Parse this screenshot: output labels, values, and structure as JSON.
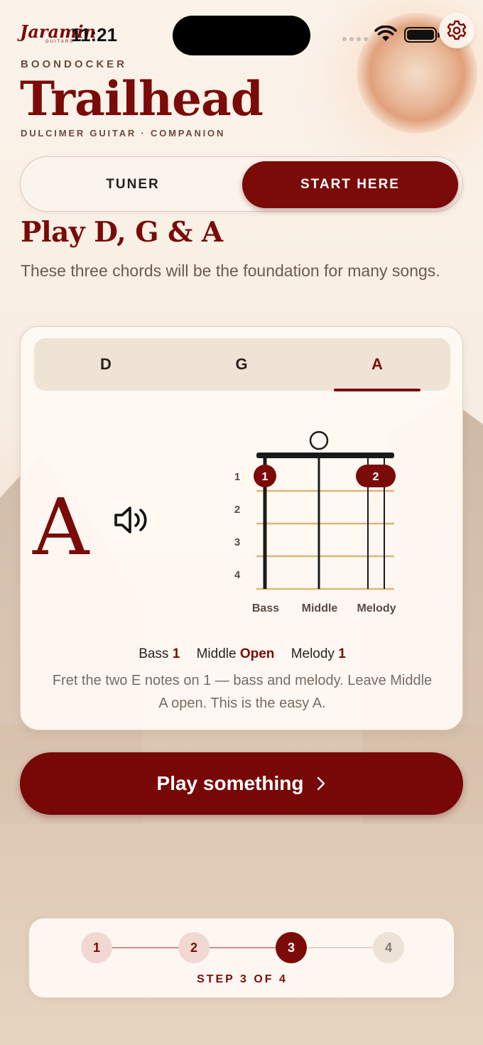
{
  "status_bar": {
    "brand_logo": "Jaramin",
    "brand_logo_sub": "GUITARS",
    "time": "11:21"
  },
  "header": {
    "eyebrow": "BOONDOCKER",
    "title": "Trailhead",
    "subtitle": "DULCIMER GUITAR · COMPANION"
  },
  "segmented": {
    "options": [
      "TUNER",
      "START HERE"
    ],
    "selected": "START HERE"
  },
  "section": {
    "title": "Play D, G & A",
    "description": "These three chords will be the foundation for many songs."
  },
  "chord_card": {
    "tabs": [
      "D",
      "G",
      "A"
    ],
    "selected_tab": "A",
    "chord_name": "A",
    "sound_icon": "speaker-icon",
    "diagram": {
      "fret_numbers": [
        "1",
        "2",
        "3",
        "4"
      ],
      "strings": [
        "Bass",
        "Middle",
        "Melody"
      ],
      "open_strings": [
        "Middle"
      ],
      "finger_markers": [
        {
          "label": "1",
          "string": "Bass",
          "fret": 1
        },
        {
          "label": "2",
          "string": "Melody",
          "fret": 1
        }
      ]
    },
    "fingering": {
      "bass_label": "Bass",
      "bass_value": "1",
      "middle_label": "Middle",
      "middle_value": "Open",
      "melody_label": "Melody",
      "melody_value": "1"
    },
    "hint": "Fret the two E notes on 1 — bass and melody. Leave Middle A open. This is the easy A."
  },
  "cta": {
    "label": "Play something",
    "icon": "chevron-right-icon"
  },
  "stepper": {
    "steps": [
      "1",
      "2",
      "3",
      "4"
    ],
    "current_step": 3,
    "label": "STEP 3 OF 4"
  },
  "colors": {
    "accent": "#7a0b09",
    "background": "#f8efe4",
    "fret_line": "#d9b779"
  }
}
